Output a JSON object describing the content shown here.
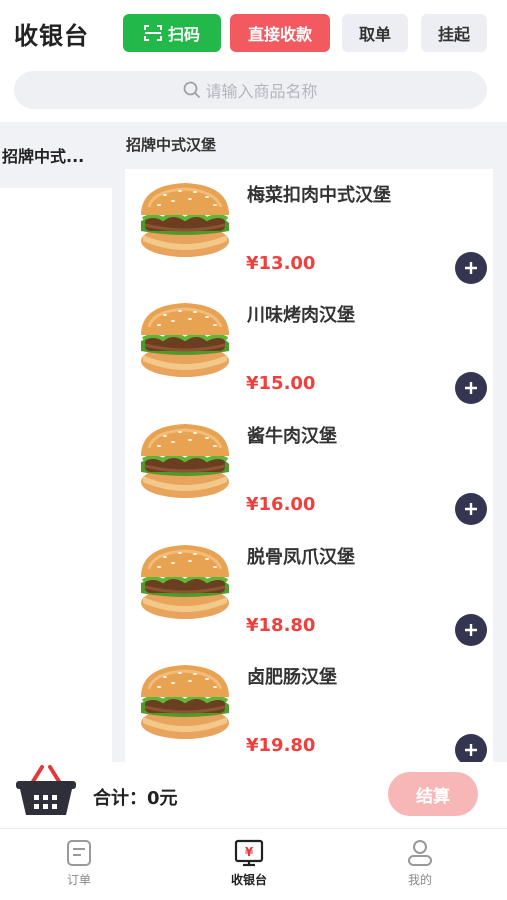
{
  "header": {
    "title": "收银台",
    "scan_label": "扫码",
    "direct_label": "直接收款",
    "fetch_label": "取单",
    "hold_label": "挂起"
  },
  "search": {
    "placeholder": "请输入商品名称"
  },
  "sidebar": {
    "items": [
      {
        "label": "招牌中式..."
      }
    ]
  },
  "category": {
    "title": "招牌中式汉堡"
  },
  "products": [
    {
      "name": "梅菜扣肉中式汉堡",
      "price": "¥13.00"
    },
    {
      "name": "川味烤肉汉堡",
      "price": "¥15.00"
    },
    {
      "name": "酱牛肉汉堡",
      "price": "¥16.00"
    },
    {
      "name": "脱骨凤爪汉堡",
      "price": "¥18.80"
    },
    {
      "name": "卤肥肠汉堡",
      "price": "¥19.80"
    }
  ],
  "cart": {
    "total_label": "合计：",
    "total_value": "0元",
    "settle_label": "结算"
  },
  "tabbar": {
    "items": [
      {
        "label": "订单",
        "icon": "order-icon"
      },
      {
        "label": "收银台",
        "icon": "cashier-icon",
        "glyph": "¥"
      },
      {
        "label": "我的",
        "icon": "profile-icon"
      }
    ]
  },
  "colors": {
    "scan_green": "#22b94a",
    "direct_red": "#f25a5f",
    "price_red": "#f0403e",
    "add_button": "#343651",
    "settle_pink": "#f7b7b7"
  }
}
